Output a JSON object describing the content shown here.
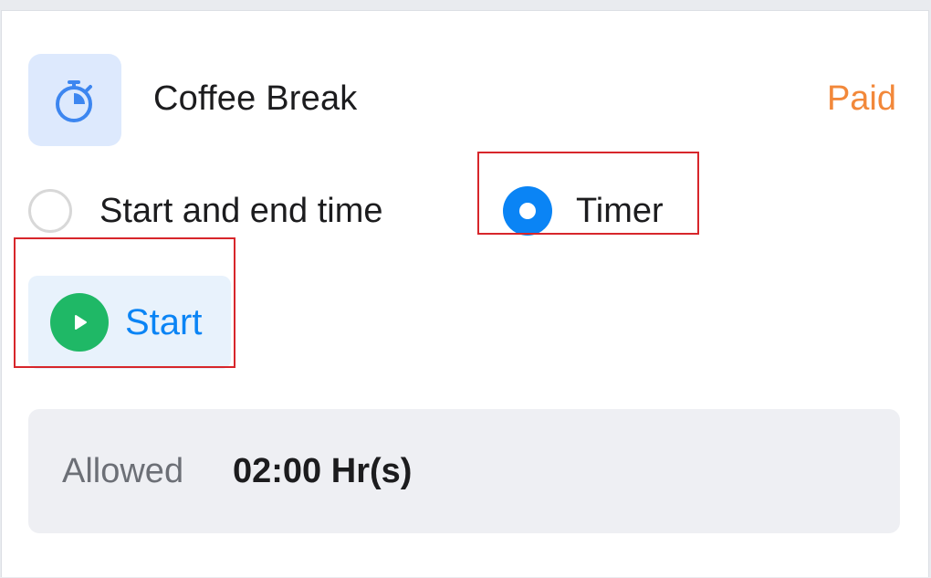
{
  "break": {
    "title": "Coffee Break",
    "type": "Paid",
    "icon": "stopwatch-icon"
  },
  "mode": {
    "options": [
      {
        "label": "Start and end time",
        "selected": false
      },
      {
        "label": "Timer",
        "selected": true
      }
    ]
  },
  "timer": {
    "start_label": "Start",
    "icon": "play-icon"
  },
  "allowance": {
    "label": "Allowed",
    "value": "02:00 Hr(s)"
  },
  "colors": {
    "accent": "#0a84f5",
    "paid": "#f2883a",
    "play": "#1fb866",
    "highlight": "#d7262b"
  }
}
